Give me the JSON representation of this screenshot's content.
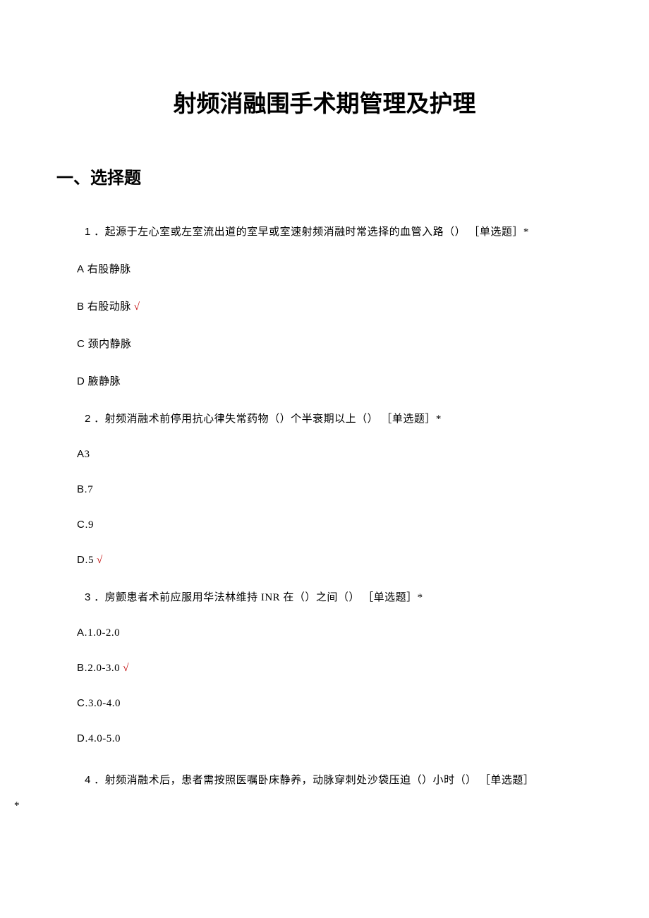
{
  "title": "射频消融围手术期管理及护理",
  "section_heading": "一、选择题",
  "questions": [
    {
      "num": "1",
      "stem": "．起源于左心室或左室流出道的室早或室速射频消融时常选择的血管入路（） ［单选题］*",
      "options": [
        {
          "letter": "A",
          "text": " 右股静脉",
          "correct": false
        },
        {
          "letter": "B",
          "text": " 右股动脉",
          "correct": true
        },
        {
          "letter": "C",
          "text": " 颈内静脉",
          "correct": false
        },
        {
          "letter": "D",
          "text": " 腋静脉",
          "correct": false
        }
      ]
    },
    {
      "num": "2",
      "stem": "．射频消融术前停用抗心律失常药物（）个半衰期以上（） ［单选题］*",
      "options": [
        {
          "letter": "A",
          "text": "3",
          "correct": false
        },
        {
          "letter": "B.",
          "text": "7",
          "correct": false
        },
        {
          "letter": "C.",
          "text": "9",
          "correct": false
        },
        {
          "letter": "D.",
          "text": "5",
          "correct": true
        }
      ]
    },
    {
      "num": "3",
      "stem": "．房颤患者术前应服用华法林维持 INR 在（）之间（） ［单选题］*",
      "options": [
        {
          "letter": "A.",
          "text": "1.0-2.0",
          "correct": false
        },
        {
          "letter": "B.",
          "text": "2.0-3.0",
          "correct": true
        },
        {
          "letter": "C.",
          "text": "3.0-4.0",
          "correct": false
        },
        {
          "letter": "D.",
          "text": "4.0-5.0",
          "correct": false
        }
      ]
    },
    {
      "num": "4",
      "stem_line1": "．射频消融术后，患者需按照医嘱卧床静养，动脉穿刺处沙袋压迫（）小时（） ［单选题］",
      "stem_line2": "*",
      "options": []
    }
  ],
  "correct_mark": "√"
}
